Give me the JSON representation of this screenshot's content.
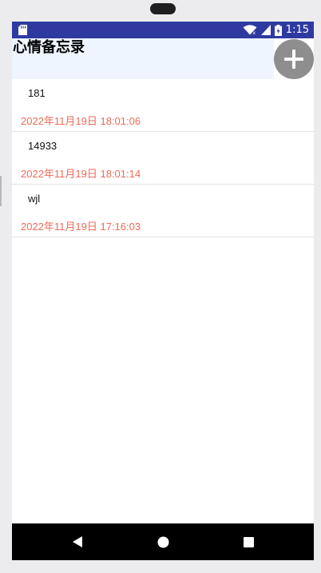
{
  "status_bar": {
    "time": "1:15",
    "background": "#2f3aa0",
    "icons": [
      "sd-card-icon",
      "wifi-icon",
      "signal-icon",
      "battery-icon"
    ]
  },
  "app": {
    "title": "心情备忘录",
    "header_background": "#eef5ff",
    "fab_icon": "plus-icon",
    "fab_color": "#8e8e8e"
  },
  "notes": [
    {
      "content": "181",
      "time": "2022年11月19日 18:01:06"
    },
    {
      "content": "14933",
      "time": "2022年11月19日 18:01:14"
    },
    {
      "content": "wjl",
      "time": "2022年11月19日 17:16:03"
    }
  ],
  "time_color": "#ef6a5a",
  "nav_bar": {
    "buttons": [
      "back-icon",
      "home-icon",
      "recents-icon"
    ]
  }
}
